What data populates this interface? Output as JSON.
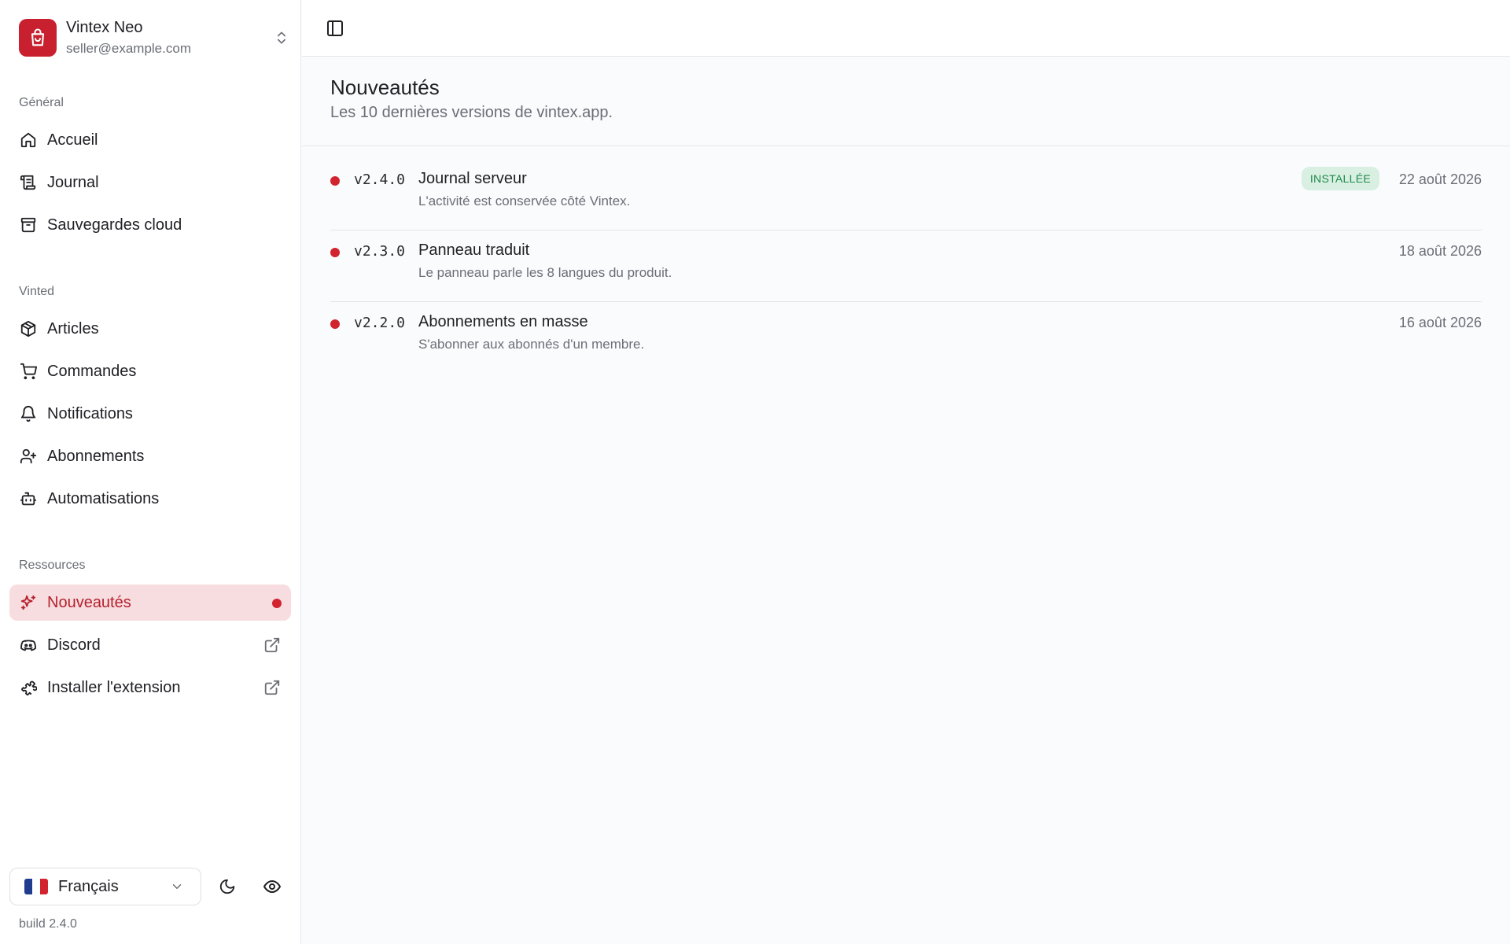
{
  "brand": {
    "name": "Vintex Neo",
    "email": "seller@example.com",
    "logo_color": "#c8202e"
  },
  "sections": {
    "general": "Général",
    "vinted": "Vinted",
    "resources": "Ressources"
  },
  "nav": {
    "home": {
      "label": "Accueil",
      "icon": "home-icon"
    },
    "journal": {
      "label": "Journal",
      "icon": "scroll-icon"
    },
    "backups": {
      "label": "Sauvegardes cloud",
      "icon": "archive-icon"
    },
    "articles": {
      "label": "Articles",
      "icon": "package-icon"
    },
    "orders": {
      "label": "Commandes",
      "icon": "cart-icon"
    },
    "notifications": {
      "label": "Notifications",
      "icon": "bell-icon"
    },
    "subscriptions": {
      "label": "Abonnements",
      "icon": "user-plus-icon"
    },
    "automations": {
      "label": "Automatisations",
      "icon": "bot-icon"
    },
    "news": {
      "label": "Nouveautés",
      "icon": "sparkles-icon",
      "active": true
    },
    "discord": {
      "label": "Discord",
      "icon": "discord-icon"
    },
    "extension": {
      "label": "Installer l'extension",
      "icon": "puzzle-icon"
    }
  },
  "footer": {
    "language": "Français",
    "build": "build 2.4.0"
  },
  "page": {
    "title": "Nouveautés",
    "subtitle": "Les 10 dernières versions de vintex.app."
  },
  "releases": [
    {
      "version": "v2.4.0",
      "title": "Journal serveur",
      "description": "L'activité est conservée côté Vintex.",
      "date": "22 août 2026",
      "badge": "INSTALLÉE"
    },
    {
      "version": "v2.3.0",
      "title": "Panneau traduit",
      "description": "Le panneau parle les 8 langues du produit.",
      "date": "18 août 2026"
    },
    {
      "version": "v2.2.0",
      "title": "Abonnements en masse",
      "description": "S'abonner aux abonnés d'un membre.",
      "date": "16 août 2026"
    }
  ],
  "colors": {
    "accent": "#c8202e",
    "active_bg": "#f7dde0",
    "badge_bg": "#d8efe2",
    "badge_text": "#1f8a4c"
  }
}
